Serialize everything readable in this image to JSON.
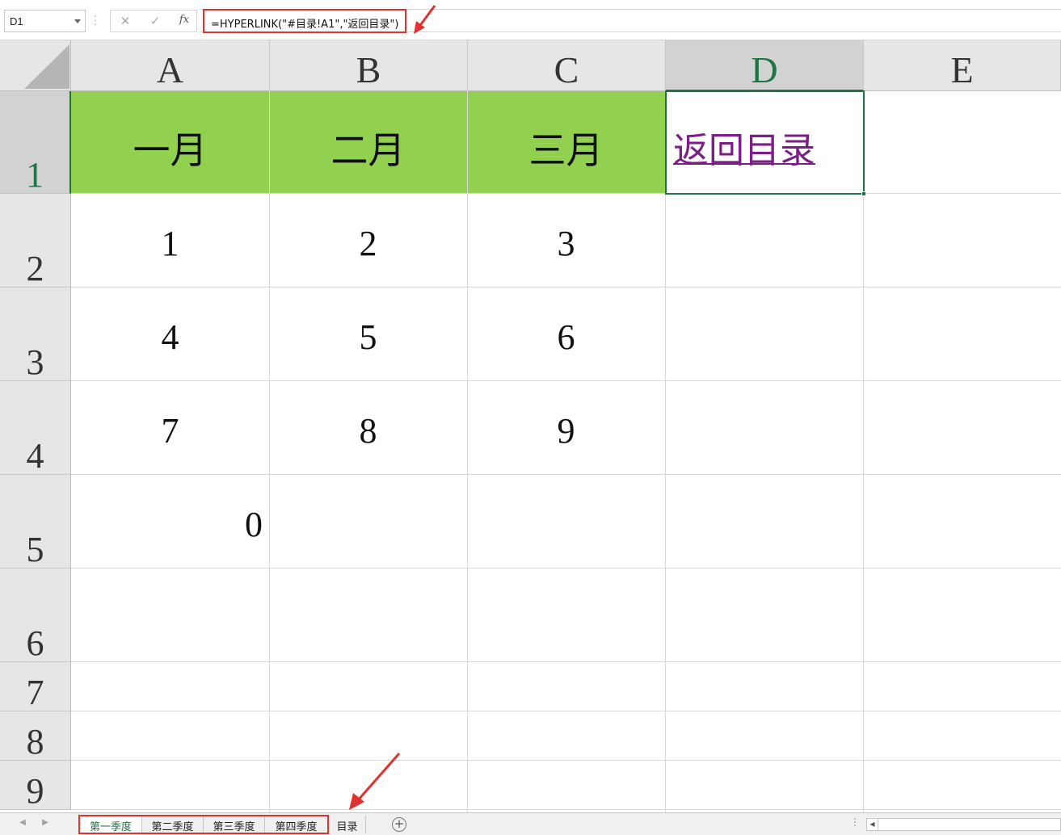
{
  "formula_bar": {
    "name_box": "D1",
    "cancel_symbol": "✕",
    "enter_symbol": "✓",
    "fx_label": "fx",
    "formula": "=HYPERLINK(\"#目录!A1\",\"返回目录\")"
  },
  "columns": [
    "A",
    "B",
    "C",
    "D",
    "E"
  ],
  "active_column": "D",
  "rows": [
    "1",
    "2",
    "3",
    "4",
    "5",
    "6",
    "7",
    "8",
    "9"
  ],
  "active_row": "1",
  "cells": {
    "A1": "一月",
    "B1": "二月",
    "C1": "三月",
    "D1": "返回目录",
    "A2": "1",
    "B2": "2",
    "C2": "3",
    "A3": "4",
    "B3": "5",
    "C3": "6",
    "A4": "7",
    "B4": "8",
    "C4": "9",
    "A5": "0"
  },
  "header_fill_color": "#92d050",
  "hyperlink_color": "#7a1f86",
  "selection_color": "#217346",
  "annotation_color": "#e0322e",
  "sheet_tabs": [
    "第一季度",
    "第二季度",
    "第三季度",
    "第四季度",
    "目录"
  ],
  "active_sheet": "第一季度",
  "add_sheet_symbol": "+"
}
